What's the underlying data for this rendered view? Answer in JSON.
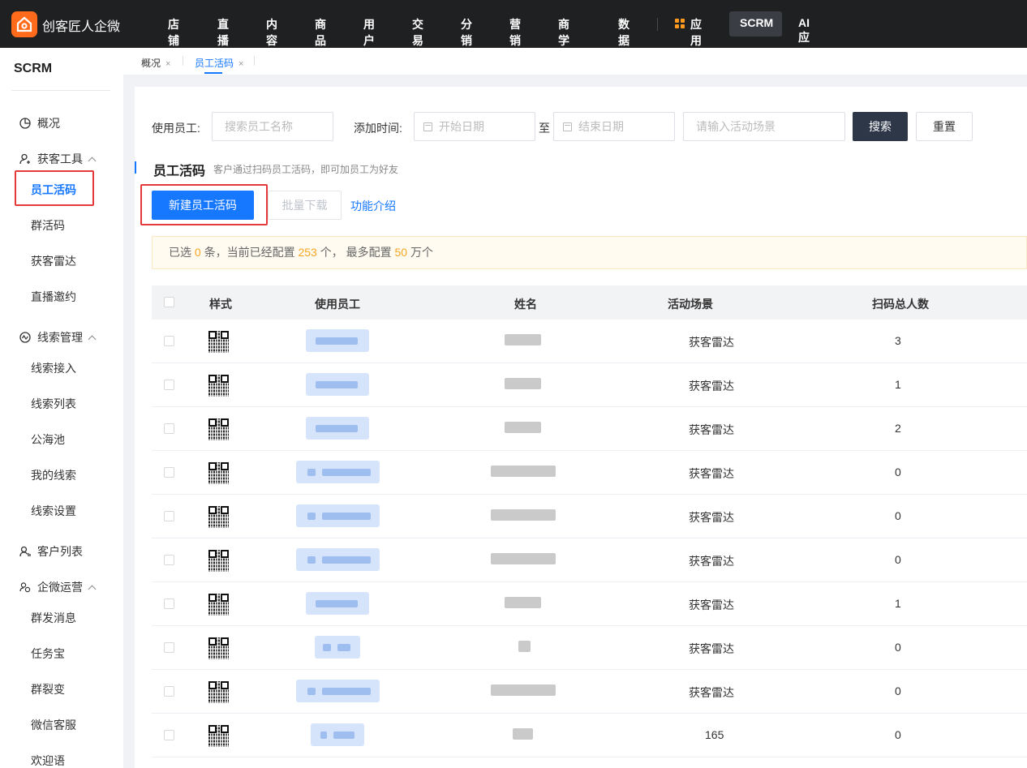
{
  "brand": {
    "name": "创客匠人企微"
  },
  "topnav": {
    "items": [
      "店铺",
      "直播",
      "内容",
      "商品",
      "用户",
      "交易",
      "分销",
      "营销",
      "商学院",
      "数据",
      "应用",
      "SCRM",
      "AI应用"
    ]
  },
  "sidebar": {
    "title": "SCRM",
    "overview": "概况",
    "groups": [
      {
        "label": "获客工具",
        "items": [
          "员工活码",
          "群活码",
          "获客雷达",
          "直播邀约"
        ]
      },
      {
        "label": "线索管理",
        "items": [
          "线索接入",
          "线索列表",
          "公海池",
          "我的线索",
          "线索设置"
        ]
      },
      {
        "label": "客户列表",
        "items": []
      },
      {
        "label": "企微运营",
        "items": [
          "群发消息",
          "任务宝",
          "群裂变",
          "微信客服",
          "欢迎语"
        ]
      }
    ]
  },
  "tabs": [
    {
      "label": "概况",
      "close": "×"
    },
    {
      "label": "员工活码",
      "close": "×"
    }
  ],
  "filters": {
    "employee_label": "使用员工:",
    "employee_placeholder": "搜索员工名称",
    "time_label": "添加时间:",
    "start_placeholder": "开始日期",
    "to": "至",
    "end_placeholder": "结束日期",
    "scene_placeholder": "请输入活动场景",
    "search_btn": "搜索",
    "reset_btn": "重置"
  },
  "section": {
    "title": "员工活码",
    "subtitle": "客户通过扫码员工活码，即可加员工为好友"
  },
  "actions": {
    "new": "新建员工活码",
    "batch_download": "批量下载",
    "intro": "功能介绍"
  },
  "notice": {
    "p1": "已选 ",
    "selected": "0",
    "p2": " 条，当前已经配置 ",
    "configured": "253",
    "p3": " 个， 最多配置 ",
    "max": "50",
    "p4": " 万个"
  },
  "table": {
    "headers": [
      "样式",
      "使用员工",
      "姓名",
      "活动场景",
      "扫码总人数"
    ],
    "rows": [
      {
        "scene": "获客雷达",
        "scans": "3"
      },
      {
        "scene": "获客雷达",
        "scans": "1"
      },
      {
        "scene": "获客雷达",
        "scans": "2"
      },
      {
        "scene": "获客雷达",
        "scans": "0"
      },
      {
        "scene": "获客雷达",
        "scans": "0"
      },
      {
        "scene": "获客雷达",
        "scans": "0"
      },
      {
        "scene": "获客雷达",
        "scans": "1"
      },
      {
        "scene": "获客雷达",
        "scans": "0"
      },
      {
        "scene": "获客雷达",
        "scans": "0"
      },
      {
        "scene": "165",
        "scans": "0"
      }
    ]
  }
}
